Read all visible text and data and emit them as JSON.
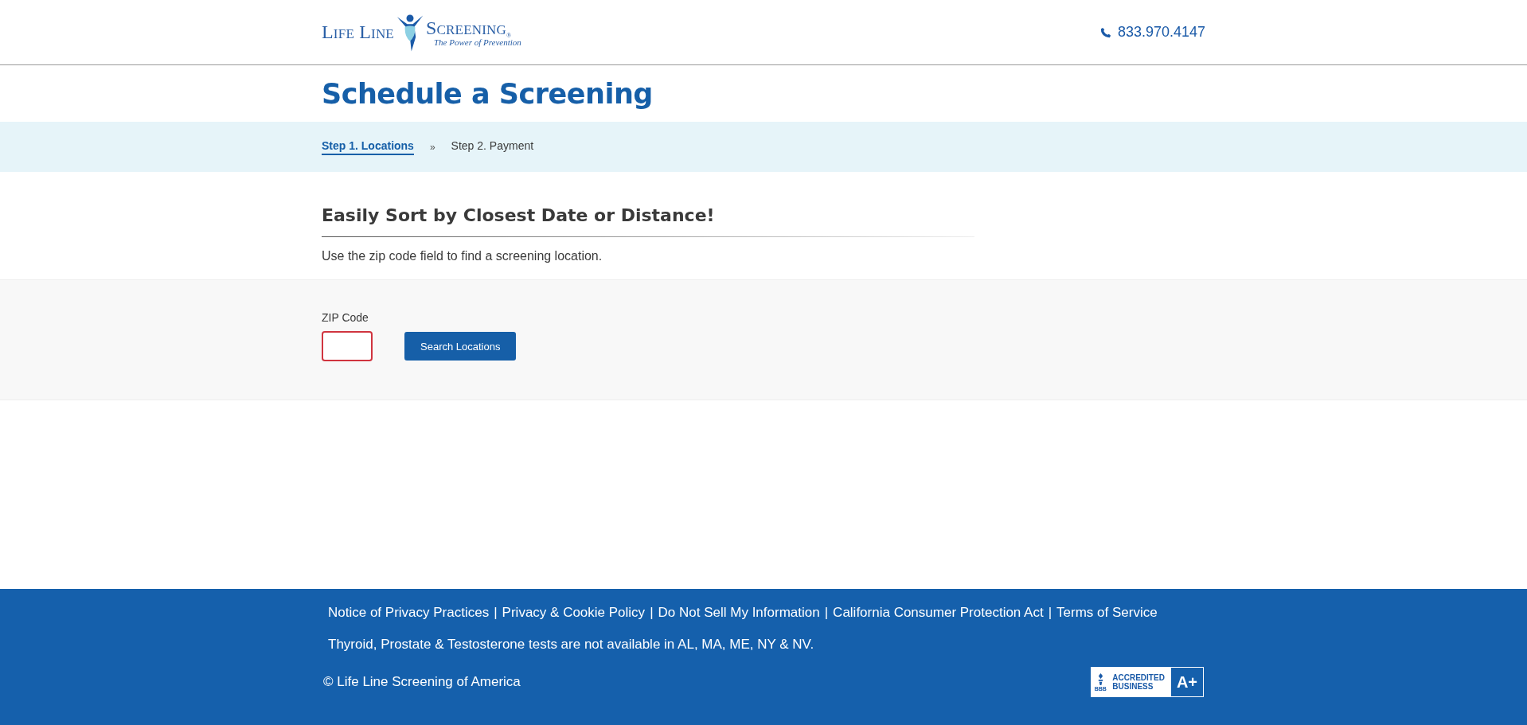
{
  "header": {
    "logo": {
      "left": "Life Line",
      "right": "Screening",
      "mark": "®",
      "tagline": "The Power of Prevention"
    },
    "phone": "833.970.4147"
  },
  "page_title": "Schedule a Screening",
  "steps": [
    {
      "label": "Step 1. Locations",
      "selected": true,
      "separator": "»"
    },
    {
      "label": "Step 2. Payment",
      "selected": false
    }
  ],
  "section": {
    "heading": "Easily Sort by Closest Date or Distance!",
    "text": "Use the zip code field to find a screening location."
  },
  "form": {
    "zip_label": "ZIP Code",
    "zip_invalid": true,
    "button": "Search Locations"
  },
  "footer": {
    "links": [
      {
        "label": "Notice of Privacy Practices",
        "separator": "|"
      },
      {
        "label": "Privacy & Cookie Policy",
        "separator": "|"
      },
      {
        "label": "Do Not Sell My Information",
        "separator": "|"
      },
      {
        "label": "California Consumer Protection Act",
        "separator": "|"
      },
      {
        "label": "Terms of Service"
      }
    ],
    "notice": "Thyroid, Prostate & Testosterone tests are not available in AL, MA, ME, NY & NV.",
    "copyright": "© Life Line Screening of America",
    "badge": {
      "org": "BBB",
      "line1": "ACCREDITED",
      "line2": "BUSINESS",
      "rating": "A+"
    }
  }
}
